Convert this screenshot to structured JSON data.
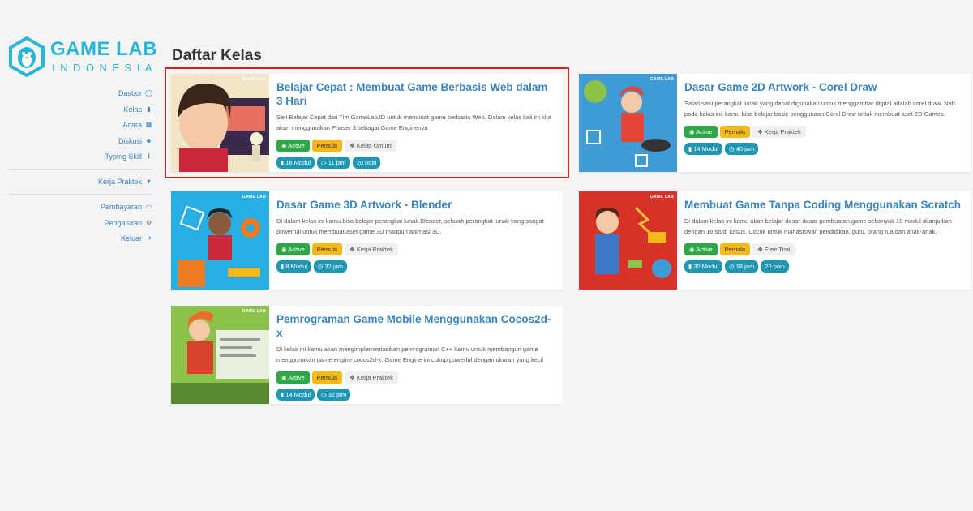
{
  "brand": {
    "title": "GAME LAB",
    "subtitle": "INDONESIA",
    "thumb_brand": "GAME LAB"
  },
  "nav": {
    "items": [
      {
        "label": "Dasbor",
        "icon": "dashboard-icon"
      },
      {
        "label": "Kelas",
        "icon": "book-icon"
      },
      {
        "label": "Acara",
        "icon": "calendar-icon"
      },
      {
        "label": "Diskusi",
        "icon": "users-icon"
      },
      {
        "label": "Typing Skill",
        "icon": "text-cursor-icon"
      }
    ],
    "dropdown": {
      "label": "Kerja Praktek",
      "icon": "caret-down-icon"
    },
    "bottom_items": [
      {
        "label": "Pembayaran",
        "icon": "credit-card-icon"
      },
      {
        "label": "Pengaturan",
        "icon": "gear-icon"
      },
      {
        "label": "Keluar",
        "icon": "sign-out-icon"
      }
    ]
  },
  "page": {
    "title": "Daftar Kelas"
  },
  "cards": [
    {
      "title": "Belajar Cepat : Membuat Game Berbasis Web dalam 3 Hari",
      "desc": "Seri Belajar Cepat dari Tim GameLab.ID untuk membuat game berbasis Web. Dalam kelas kali ini kita akan menggunakan Phaser 3 sebagai Game Enginenya",
      "status": "Active",
      "level": "Pemula",
      "category": "Kelas Umum",
      "modul": "16 Modul",
      "hours": "11 jam",
      "points": "20 poin",
      "colors": {
        "bg": "#f2e4c6",
        "accent": "#3a2a4a"
      }
    },
    {
      "title": "Dasar Game 2D Artwork - Corel Draw",
      "desc": "Salah satu perangkat lunak yang dapat digunakan untuk menggambar digital adalah corel draw. Nah pada kelas ini, kamu bisa belajar basic penggunaan Corel Draw untuk membuat aset 2D Games.",
      "status": "Active",
      "level": "Pemula",
      "category": "Kerja Praktek",
      "modul": "14 Modul",
      "hours": "40 jam",
      "points": "",
      "colors": {
        "bg": "#3f9ad8",
        "accent": "#e5463a"
      }
    },
    {
      "title": "Dasar Game 3D Artwork - Blender",
      "desc": "Di dalam kelas ini kamu bisa belajar perangkat lunak Blender, sebuah perangkat lunak yang sangat powerfull untuk membuat aset game 3D maupun animasi 3D.",
      "status": "Active",
      "level": "Pemula",
      "category": "Kerja Praktek",
      "modul": "8 Modul",
      "hours": "32 jam",
      "points": "",
      "colors": {
        "bg": "#27aee3",
        "accent": "#f07a22"
      }
    },
    {
      "title": "Membuat Game Tanpa Coding Menggunakan Scratch",
      "desc": "Di dalam kelas ini kamu akan belajar dasar-dasar pembuatan game sebanyak 10 modul dilanjutkan dengan 16 studi kasus. Cocok untuk mahasiswa/i pendidikan, guru, orang tua dan anak-anak.",
      "status": "Active",
      "level": "Pemula",
      "category": "Free Trial",
      "modul": "30 Modul",
      "hours": "18 jam",
      "points": "20 poin",
      "colors": {
        "bg": "#d83228",
        "accent": "#f7c23a"
      }
    },
    {
      "title": "Pemrograman Game Mobile Menggunakan Cocos2d-x",
      "desc": "Di kelas ini kamu akan mengimplementasikan pemrograman C++ kamu untuk membangun game menggunakan game engine cocos2d-x. Game Engine ini cukup powerful dengan ukuran yang kecil",
      "status": "Active",
      "level": "Pemula",
      "category": "Kerja Praktek",
      "modul": "14 Modul",
      "hours": "32 jam",
      "points": "",
      "colors": {
        "bg": "#8cc24a",
        "accent": "#f06a2a"
      }
    }
  ]
}
